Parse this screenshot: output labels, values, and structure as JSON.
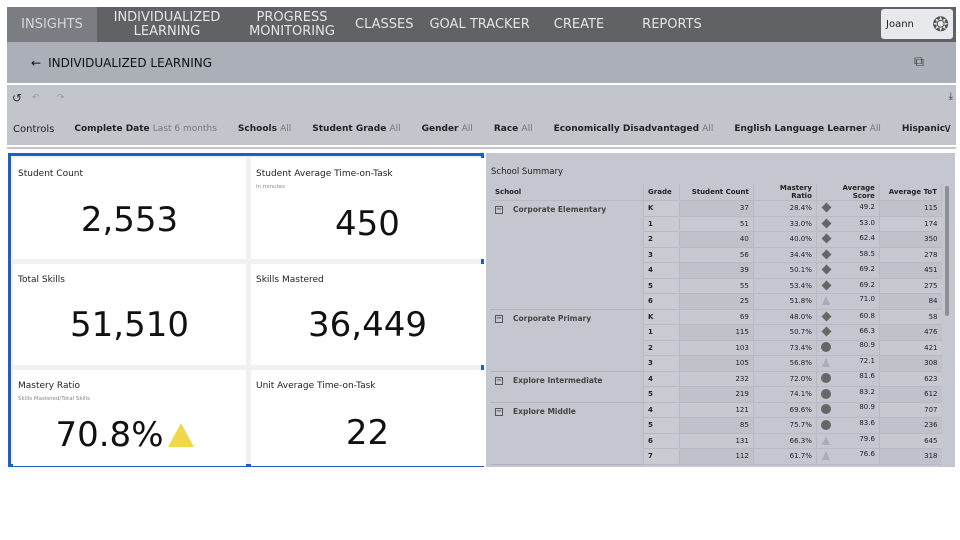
{
  "nav": {
    "tabs": [
      "INSIGHTS",
      "INDIVIDUALIZED LEARNING",
      "PROGRESS MONITORING",
      "CLASSES",
      "GOAL TRACKER",
      "CREATE",
      "REPORTS"
    ],
    "user": "Joann"
  },
  "page": {
    "title": "INDIVIDUALIZED LEARNING"
  },
  "controls": {
    "label": "Controls",
    "filters": [
      {
        "name": "Complete Date",
        "value": "Last 6 months"
      },
      {
        "name": "Schools",
        "value": "All"
      },
      {
        "name": "Student Grade",
        "value": "All"
      },
      {
        "name": "Gender",
        "value": "All"
      },
      {
        "name": "Race",
        "value": "All"
      },
      {
        "name": "Economically Disadvantaged",
        "value": "All"
      },
      {
        "name": "English Language Learner",
        "value": "All"
      },
      {
        "name": "Hispanic",
        "value": ""
      }
    ]
  },
  "kpis": [
    {
      "title": "Student Count",
      "sub": "",
      "value": "2,553"
    },
    {
      "title": "Student Average Time-on-Task",
      "sub": "in minutes",
      "value": "450"
    },
    {
      "title": "Total Skills",
      "sub": "",
      "value": "51,510"
    },
    {
      "title": "Skills Mastered",
      "sub": "",
      "value": "36,449"
    },
    {
      "title": "Mastery Ratio",
      "sub": "Skills Mastered/Total Skills",
      "value": "70.8%"
    },
    {
      "title": "Unit Average Time-on-Task",
      "sub": "",
      "value": "22"
    }
  ],
  "summary": {
    "title": "School Summary",
    "columns": [
      "School",
      "Grade",
      "Student Count",
      "Mastery Ratio",
      "Average Score",
      "Average ToT"
    ],
    "schools": [
      {
        "name": "Corporate Elementary",
        "rows": [
          [
            "K",
            "37",
            "28.4%",
            "diamond",
            "49.2",
            "115"
          ],
          [
            "1",
            "51",
            "33.0%",
            "diamond",
            "53.0",
            "174"
          ],
          [
            "2",
            "40",
            "40.0%",
            "diamond",
            "62.4",
            "350"
          ],
          [
            "3",
            "56",
            "34.4%",
            "diamond",
            "58.5",
            "278"
          ],
          [
            "4",
            "39",
            "50.1%",
            "diamond",
            "69.2",
            "451"
          ],
          [
            "5",
            "55",
            "53.4%",
            "diamond",
            "69.2",
            "275"
          ],
          [
            "6",
            "25",
            "51.8%",
            "triangle",
            "71.0",
            "84"
          ]
        ]
      },
      {
        "name": "Corporate Primary",
        "rows": [
          [
            "K",
            "69",
            "48.0%",
            "diamond",
            "60.8",
            "58"
          ],
          [
            "1",
            "115",
            "50.7%",
            "diamond",
            "66.3",
            "476"
          ],
          [
            "2",
            "103",
            "73.4%",
            "circle",
            "80.9",
            "421"
          ],
          [
            "3",
            "105",
            "56.8%",
            "triangle",
            "72.1",
            "308"
          ]
        ]
      },
      {
        "name": "Explore Intermediate",
        "rows": [
          [
            "4",
            "232",
            "72.0%",
            "circle",
            "81.6",
            "623"
          ],
          [
            "5",
            "219",
            "74.1%",
            "circle",
            "83.2",
            "612"
          ]
        ]
      },
      {
        "name": "Explore Middle",
        "rows": [
          [
            "4",
            "121",
            "69.6%",
            "circle",
            "80.9",
            "707"
          ],
          [
            "5",
            "85",
            "75.7%",
            "circle",
            "83.6",
            "236"
          ],
          [
            "6",
            "131",
            "66.3%",
            "triangle",
            "79.6",
            "645"
          ],
          [
            "7",
            "112",
            "61.7%",
            "triangle",
            "76.6",
            "318"
          ]
        ]
      }
    ]
  }
}
